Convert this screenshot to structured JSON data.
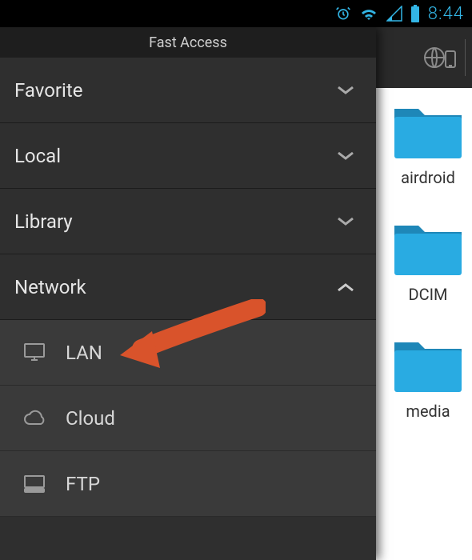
{
  "status": {
    "time": "8:44"
  },
  "drawer": {
    "title": "Fast Access",
    "sections": [
      {
        "label": "Favorite",
        "expanded": false
      },
      {
        "label": "Local",
        "expanded": false
      },
      {
        "label": "Library",
        "expanded": false
      },
      {
        "label": "Network",
        "expanded": true,
        "items": [
          {
            "label": "LAN",
            "icon": "monitor-icon"
          },
          {
            "label": "Cloud",
            "icon": "cloud-icon"
          },
          {
            "label": "FTP",
            "icon": "server-icon"
          }
        ]
      }
    ]
  },
  "folders": [
    {
      "label": "airdroid"
    },
    {
      "label": "DCIM"
    },
    {
      "label": "media"
    }
  ],
  "colors": {
    "accent": "#33b5e5",
    "folder": "#29abe2",
    "arrow": "#d9532b"
  }
}
